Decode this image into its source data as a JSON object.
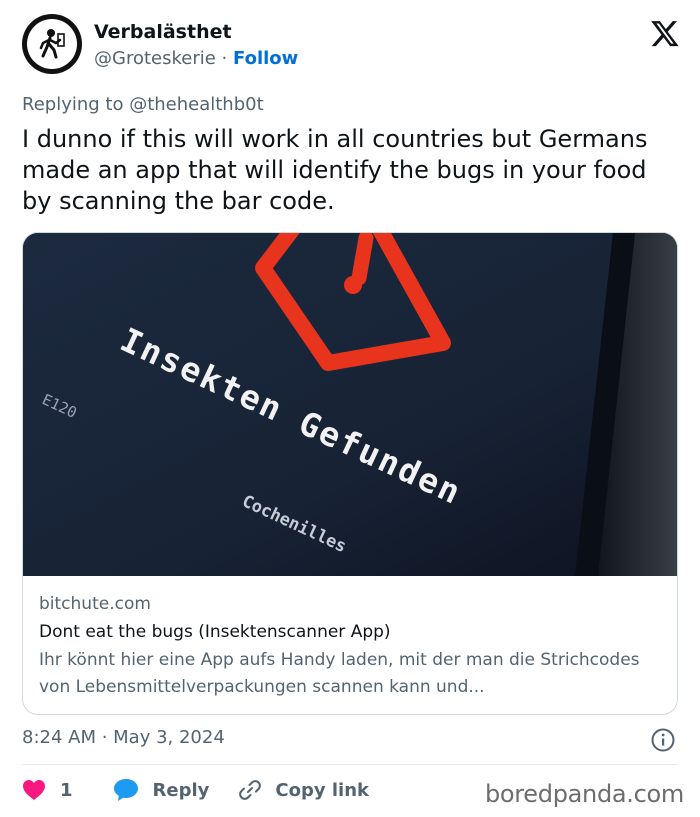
{
  "author": {
    "display_name": "Verbalästhet",
    "handle": "@Groteskerie",
    "separator": "·",
    "follow_label": "Follow",
    "avatar_icon": "person-walking-icon"
  },
  "platform_logo": "x-logo-icon",
  "replying_to": "Replying to @thehealthb0t",
  "tweet_text": "I dunno if this will work in all countries but Germans made an app that will identify the bugs in your food by scanning the bar code.",
  "card": {
    "image": {
      "headline": "Insekten Gefunden",
      "code": "E120",
      "sub": "Cochenilles",
      "warning_color": "#e8341c"
    },
    "domain": "bitchute.com",
    "title": "Dont eat the bugs (Insektenscanner App)",
    "description": "Ihr könnt hier eine App aufs Handy laden, mit der man die Strichcodes von Lebensmittelverpackungen scannen kann und..."
  },
  "timestamp": "8:24 AM · May 3, 2024",
  "actions": {
    "like_count": "1",
    "reply_label": "Reply",
    "copy_label": "Copy link"
  },
  "colors": {
    "accent": "#006fd6",
    "like": "#f91880",
    "reply": "#1d9bf0"
  },
  "watermark": "boredpanda.com"
}
